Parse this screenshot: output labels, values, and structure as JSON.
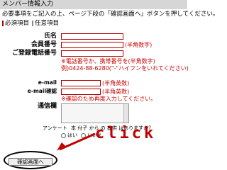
{
  "header": {
    "title": "メンバー情報入力"
  },
  "instruction": "必要事項をご記入の上、ページ下段の「確認画面へ」ボタンを押してください。",
  "legend": {
    "required": "必須項目",
    "optional": "任意項目"
  },
  "fields": {
    "name_label": "氏名",
    "member_no_label": "会員番号",
    "member_no_note": "(半角数字)",
    "phone_label": "ご登録電話番号",
    "phone_note1": "※電話番号か、携帯番号を(半角数字)",
    "phone_note2": "例)0424-88-6280(\"-\"ハイフンをいれてください)",
    "email_label": "e-mail",
    "email_note": "(半角英数)",
    "email_confirm_label": "e-mail確認",
    "email_confirm_note": "(半角英数)",
    "email_confirm_note2": "※確認のため再度入力してください。",
    "comm_label": "通信欄"
  },
  "survey": {
    "label": "アンケート",
    "question": "本 付子 から の 提供 はありますか？",
    "yes": "はい",
    "no": "いいえ"
  },
  "confirm_button": "確認画面へ",
  "annotation": "click",
  "colors": {
    "required_bar": "#b00000",
    "note": "#cc0000",
    "annotation": "#c00000",
    "header_bg": "#d6d6d6"
  }
}
